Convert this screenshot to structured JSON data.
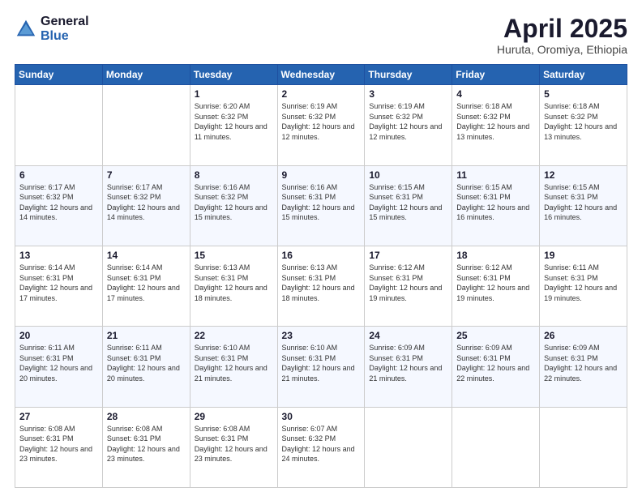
{
  "logo": {
    "general": "General",
    "blue": "Blue"
  },
  "title": {
    "month": "April 2025",
    "location": "Huruta, Oromiya, Ethiopia"
  },
  "days_of_week": [
    "Sunday",
    "Monday",
    "Tuesday",
    "Wednesday",
    "Thursday",
    "Friday",
    "Saturday"
  ],
  "weeks": [
    [
      {
        "day": "",
        "info": ""
      },
      {
        "day": "",
        "info": ""
      },
      {
        "day": "1",
        "info": "Sunrise: 6:20 AM\nSunset: 6:32 PM\nDaylight: 12 hours and 11 minutes."
      },
      {
        "day": "2",
        "info": "Sunrise: 6:19 AM\nSunset: 6:32 PM\nDaylight: 12 hours and 12 minutes."
      },
      {
        "day": "3",
        "info": "Sunrise: 6:19 AM\nSunset: 6:32 PM\nDaylight: 12 hours and 12 minutes."
      },
      {
        "day": "4",
        "info": "Sunrise: 6:18 AM\nSunset: 6:32 PM\nDaylight: 12 hours and 13 minutes."
      },
      {
        "day": "5",
        "info": "Sunrise: 6:18 AM\nSunset: 6:32 PM\nDaylight: 12 hours and 13 minutes."
      }
    ],
    [
      {
        "day": "6",
        "info": "Sunrise: 6:17 AM\nSunset: 6:32 PM\nDaylight: 12 hours and 14 minutes."
      },
      {
        "day": "7",
        "info": "Sunrise: 6:17 AM\nSunset: 6:32 PM\nDaylight: 12 hours and 14 minutes."
      },
      {
        "day": "8",
        "info": "Sunrise: 6:16 AM\nSunset: 6:32 PM\nDaylight: 12 hours and 15 minutes."
      },
      {
        "day": "9",
        "info": "Sunrise: 6:16 AM\nSunset: 6:31 PM\nDaylight: 12 hours and 15 minutes."
      },
      {
        "day": "10",
        "info": "Sunrise: 6:15 AM\nSunset: 6:31 PM\nDaylight: 12 hours and 15 minutes."
      },
      {
        "day": "11",
        "info": "Sunrise: 6:15 AM\nSunset: 6:31 PM\nDaylight: 12 hours and 16 minutes."
      },
      {
        "day": "12",
        "info": "Sunrise: 6:15 AM\nSunset: 6:31 PM\nDaylight: 12 hours and 16 minutes."
      }
    ],
    [
      {
        "day": "13",
        "info": "Sunrise: 6:14 AM\nSunset: 6:31 PM\nDaylight: 12 hours and 17 minutes."
      },
      {
        "day": "14",
        "info": "Sunrise: 6:14 AM\nSunset: 6:31 PM\nDaylight: 12 hours and 17 minutes."
      },
      {
        "day": "15",
        "info": "Sunrise: 6:13 AM\nSunset: 6:31 PM\nDaylight: 12 hours and 18 minutes."
      },
      {
        "day": "16",
        "info": "Sunrise: 6:13 AM\nSunset: 6:31 PM\nDaylight: 12 hours and 18 minutes."
      },
      {
        "day": "17",
        "info": "Sunrise: 6:12 AM\nSunset: 6:31 PM\nDaylight: 12 hours and 19 minutes."
      },
      {
        "day": "18",
        "info": "Sunrise: 6:12 AM\nSunset: 6:31 PM\nDaylight: 12 hours and 19 minutes."
      },
      {
        "day": "19",
        "info": "Sunrise: 6:11 AM\nSunset: 6:31 PM\nDaylight: 12 hours and 19 minutes."
      }
    ],
    [
      {
        "day": "20",
        "info": "Sunrise: 6:11 AM\nSunset: 6:31 PM\nDaylight: 12 hours and 20 minutes."
      },
      {
        "day": "21",
        "info": "Sunrise: 6:11 AM\nSunset: 6:31 PM\nDaylight: 12 hours and 20 minutes."
      },
      {
        "day": "22",
        "info": "Sunrise: 6:10 AM\nSunset: 6:31 PM\nDaylight: 12 hours and 21 minutes."
      },
      {
        "day": "23",
        "info": "Sunrise: 6:10 AM\nSunset: 6:31 PM\nDaylight: 12 hours and 21 minutes."
      },
      {
        "day": "24",
        "info": "Sunrise: 6:09 AM\nSunset: 6:31 PM\nDaylight: 12 hours and 21 minutes."
      },
      {
        "day": "25",
        "info": "Sunrise: 6:09 AM\nSunset: 6:31 PM\nDaylight: 12 hours and 22 minutes."
      },
      {
        "day": "26",
        "info": "Sunrise: 6:09 AM\nSunset: 6:31 PM\nDaylight: 12 hours and 22 minutes."
      }
    ],
    [
      {
        "day": "27",
        "info": "Sunrise: 6:08 AM\nSunset: 6:31 PM\nDaylight: 12 hours and 23 minutes."
      },
      {
        "day": "28",
        "info": "Sunrise: 6:08 AM\nSunset: 6:31 PM\nDaylight: 12 hours and 23 minutes."
      },
      {
        "day": "29",
        "info": "Sunrise: 6:08 AM\nSunset: 6:31 PM\nDaylight: 12 hours and 23 minutes."
      },
      {
        "day": "30",
        "info": "Sunrise: 6:07 AM\nSunset: 6:32 PM\nDaylight: 12 hours and 24 minutes."
      },
      {
        "day": "",
        "info": ""
      },
      {
        "day": "",
        "info": ""
      },
      {
        "day": "",
        "info": ""
      }
    ]
  ]
}
